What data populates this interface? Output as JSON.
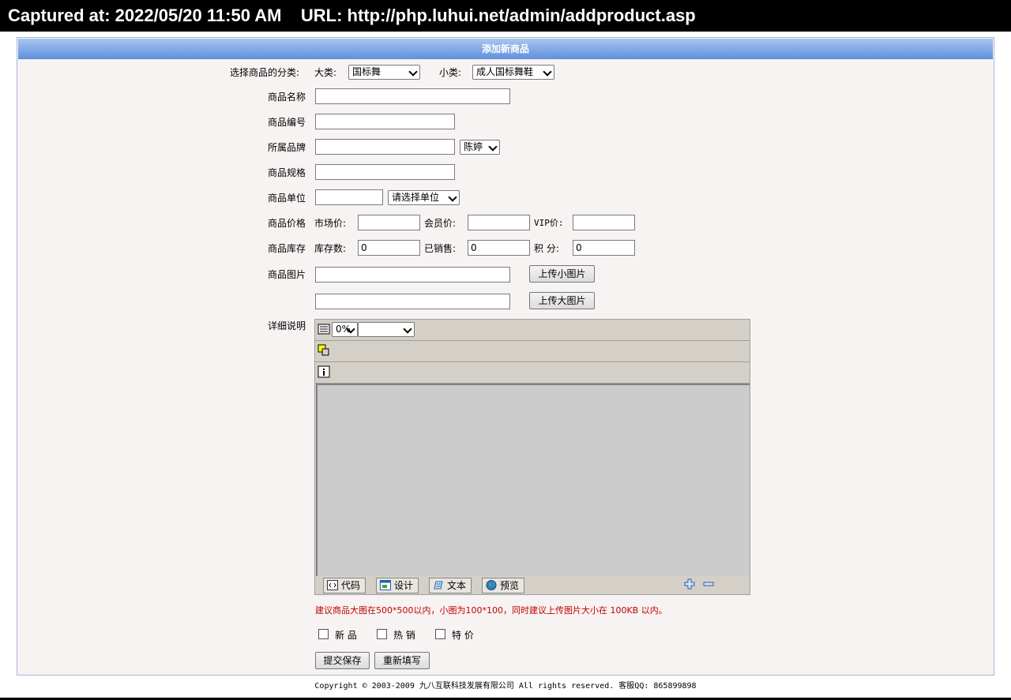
{
  "capture": {
    "text": "Captured at: 2022/05/20 11:50 AM    URL: http://php.luhui.net/admin/addproduct.asp"
  },
  "panel": {
    "title": "添加新商品"
  },
  "category": {
    "label": "选择商品的分类:",
    "major_label": "大类:",
    "major_value": "国标舞",
    "minor_label": "小类:",
    "minor_value": "成人国标舞鞋"
  },
  "fields": {
    "name_label": "商品名称",
    "code_label": "商品编号",
    "brand_label": "所属品牌",
    "brand_select": "陈婷",
    "spec_label": "商品规格",
    "unit_label": "商品单位",
    "unit_select": "请选择单位",
    "price_label": "商品价格",
    "market_price_label": "市场价:",
    "member_price_label": "会员价:",
    "vip_price_label": "VIP价:",
    "stock_label": "商品库存",
    "stock_count_label": "库存数:",
    "stock_count_value": "0",
    "sold_label": "已销售:",
    "sold_value": "0",
    "points_label": "积 分:",
    "points_value": "0",
    "image_label": "商品图片",
    "upload_small_label": "上传小图片",
    "upload_large_label": "上传大图片",
    "detail_label": "详细说明"
  },
  "editor": {
    "zoom_value": "0%",
    "tabs": [
      {
        "label": "代码",
        "icon": "code-icon"
      },
      {
        "label": "设计",
        "icon": "design-icon"
      },
      {
        "label": "文本",
        "icon": "text-icon"
      },
      {
        "label": "预览",
        "icon": "preview-globe-icon"
      }
    ]
  },
  "note": "建议商品大图在500*500以内，小图为100*100，同时建议上传图片大小在 100KB 以内。",
  "flags": {
    "new_label": "新 品",
    "hot_label": "热 销",
    "special_label": "特 价"
  },
  "actions": {
    "submit_label": "提交保存",
    "reset_label": "重新填写"
  },
  "footer": {
    "text": "Copyright © 2003-2009 九八互联科技发展有限公司 All rights reserved. 客服QQ: 865899898"
  },
  "colors": {
    "header_top": "#a9c6ee",
    "header_bottom": "#5f8fdc",
    "panel_bg": "#f7f3f2",
    "note_red": "#c00000",
    "editor_gray": "#d4d0c8"
  }
}
